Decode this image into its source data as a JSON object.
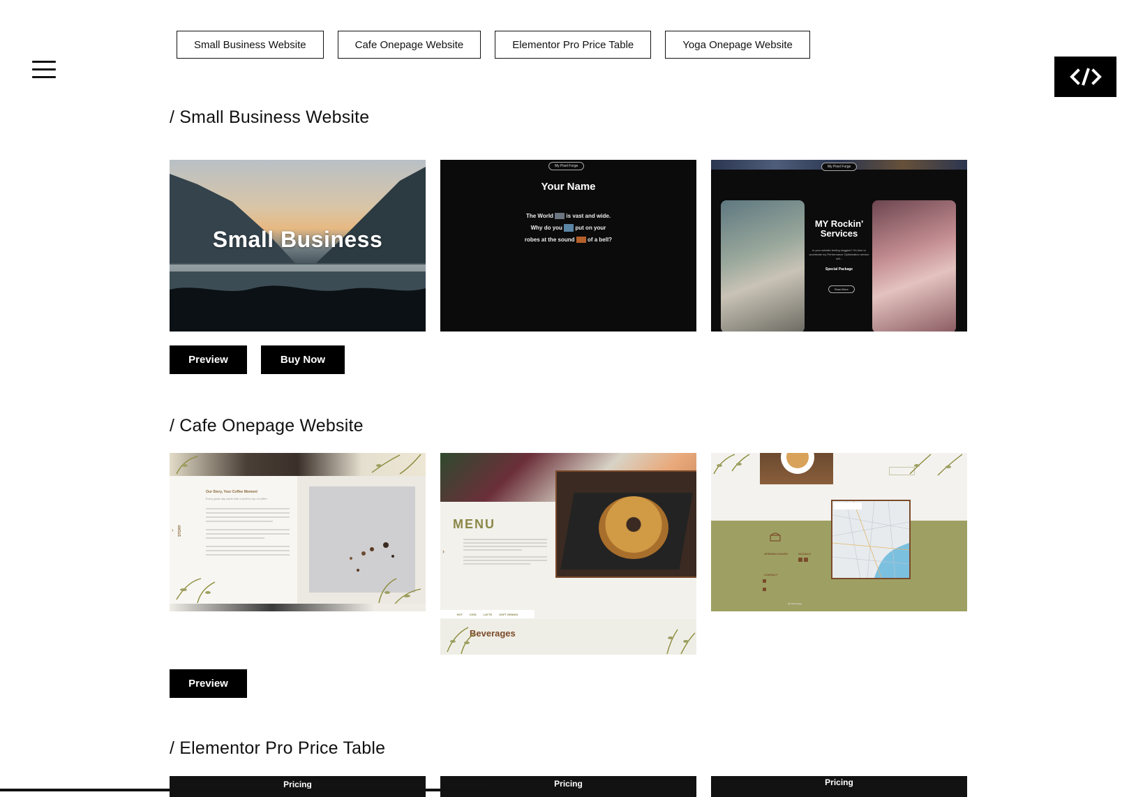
{
  "nav": {
    "buttons": [
      "Small Business Website",
      "Cafe Onepage Website",
      "Elementor Pro Price Table",
      "Yoga Onepage Website"
    ]
  },
  "sections": {
    "small_business": {
      "title": "/ Small Business Website",
      "thumb1_title": "Small Business",
      "thumb2": {
        "pill": "My Pixel Forge",
        "heading": "Your Name",
        "line1a": "The World",
        "line1b": "is vast and wide.",
        "line2a": "Why do you",
        "line2b": "put on your",
        "line3a": "robes at the sound",
        "line3b": "of a bell?"
      },
      "thumb3": {
        "pill": "My Pixel Forge",
        "heading": "MY Rockin' Services",
        "body": "Is your website feeling sluggish? It's time to accelerate my Performance Optimization service will...",
        "special": "Special Package",
        "button": "Read More"
      },
      "preview_label": "Preview",
      "buy_label": "Buy Now"
    },
    "cafe": {
      "title": "/ Cafe Onepage Website",
      "thumb1": {
        "heading": "Our Story, Your Coffee Moment",
        "sub": "Every great day starts with a perfect cup of coffee",
        "side": "STORY"
      },
      "thumb2": {
        "menu": "MENU",
        "tabs": [
          "HOT",
          "ICED",
          "LATTE",
          "SOFT DRINKS"
        ],
        "beverages": "Beverages"
      },
      "thumb3": {
        "hours": "OPENING HOURS",
        "socials": "SOCIALS",
        "contact": "CONTACT",
        "footer": "My Pixel Forge"
      },
      "preview_label": "Preview"
    },
    "price_table": {
      "title": "/ Elementor Pro Price Table",
      "thumb_labels": [
        "Pricing",
        "Pricing",
        "Pricing"
      ]
    }
  },
  "colors": {
    "accent": "#000000",
    "cafe_olive": "#9ea063",
    "cafe_brown": "#7a4a2a"
  },
  "icons": {
    "menu": "hamburger-icon",
    "code": "code-icon"
  }
}
